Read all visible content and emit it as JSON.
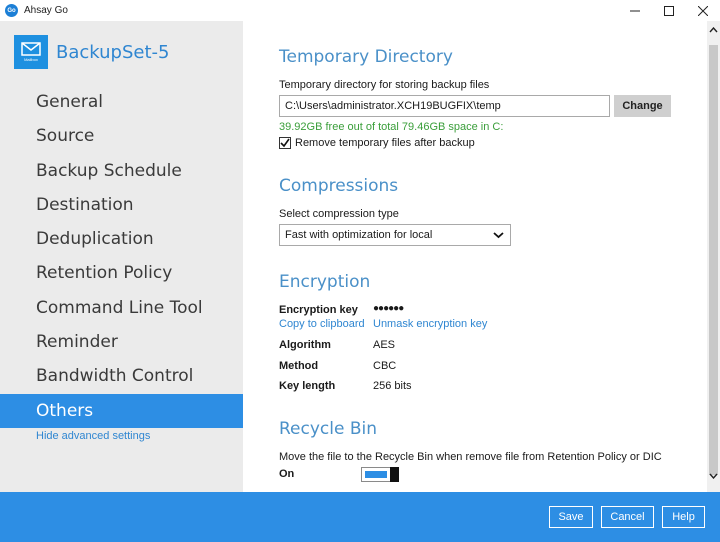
{
  "window": {
    "title": "Ahsay Go",
    "logo_text": "Go"
  },
  "sidebar": {
    "set_name": "BackupSet-5",
    "tile_caption": "Mailbox",
    "items": [
      {
        "label": "General"
      },
      {
        "label": "Source"
      },
      {
        "label": "Backup Schedule"
      },
      {
        "label": "Destination"
      },
      {
        "label": "Deduplication"
      },
      {
        "label": "Retention Policy"
      },
      {
        "label": "Command Line Tool"
      },
      {
        "label": "Reminder"
      },
      {
        "label": "Bandwidth Control"
      },
      {
        "label": "Others",
        "active": true
      }
    ],
    "hide_advanced": "Hide advanced settings"
  },
  "temp_dir": {
    "title": "Temporary Directory",
    "label": "Temporary directory for storing backup files",
    "path": "C:\\Users\\administrator.XCH19BUGFIX\\temp",
    "change_label": "Change",
    "free_space": "39.92GB free out of total 79.46GB space in C:",
    "remove_label": "Remove temporary files after backup",
    "remove_checked": true
  },
  "compressions": {
    "title": "Compressions",
    "label": "Select compression type",
    "selected": "Fast with optimization for local"
  },
  "encryption": {
    "title": "Encryption",
    "key_label": "Encryption key",
    "key_value": "●●●●●●",
    "copy_link": "Copy to clipboard",
    "unmask_link": "Unmask encryption key",
    "algorithm_label": "Algorithm",
    "algorithm_value": "AES",
    "method_label": "Method",
    "method_value": "CBC",
    "key_length_label": "Key length",
    "key_length_value": "256 bits"
  },
  "recycle_bin": {
    "title": "Recycle Bin",
    "label": "Move the file to the Recycle Bin when remove file from Retention Policy or DIC",
    "state_label": "On"
  },
  "footer": {
    "save": "Save",
    "cancel": "Cancel",
    "help": "Help"
  },
  "colors": {
    "accent": "#2d8ee4",
    "section_title": "#4a90c8",
    "free_space": "#3a9e3a"
  }
}
